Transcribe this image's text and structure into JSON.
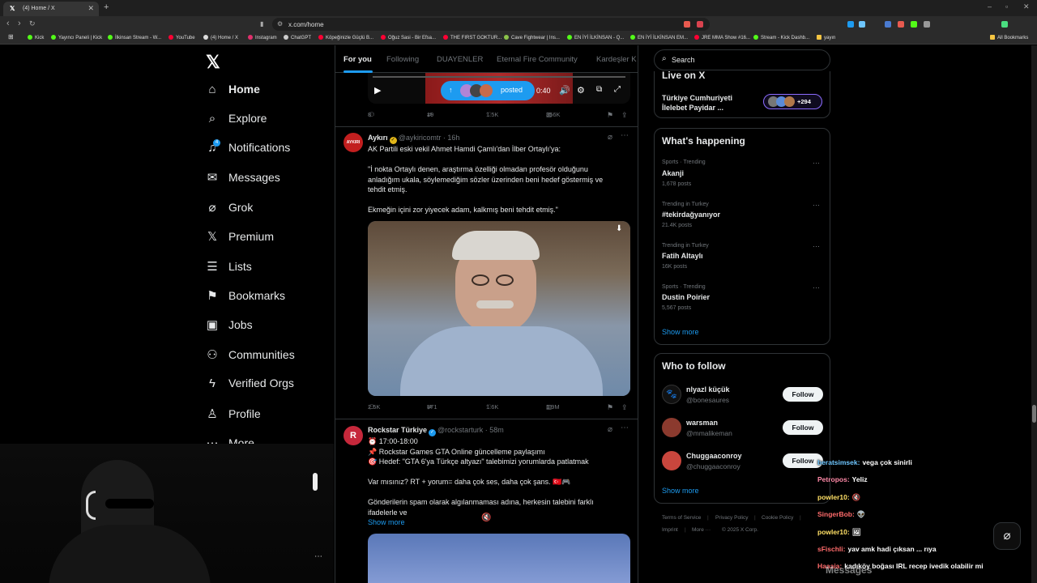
{
  "browser": {
    "tab_title": "(4) Home / X",
    "url": "x.com/home",
    "bookmarks": [
      "Kick",
      "Yayıncı Paneli | Kick",
      "İlkinsan Stream - W...",
      "YouTube",
      "(4) Home / X",
      "Instagram",
      "ChatGPT",
      "Köpeğinizle Güçlü B...",
      "Oğuz Sasi - Bir Efsa...",
      "THE FIRST GOKTUR...",
      "Cave Fightwear | Ins...",
      "EN İYİ İLKİNSAN - Q...",
      "EN İYİ İLKİNSAN EM...",
      "JRE MMA Show #16...",
      "Stream - Kick Dashb...",
      "yayın"
    ],
    "all_bookmarks": "All Bookmarks"
  },
  "nav": {
    "notif_badge": "4",
    "items": [
      {
        "label": "Home",
        "icon": "home-icon"
      },
      {
        "label": "Explore",
        "icon": "search-icon"
      },
      {
        "label": "Notifications",
        "icon": "bell-icon"
      },
      {
        "label": "Messages",
        "icon": "envelope-icon"
      },
      {
        "label": "Grok",
        "icon": "grok-icon"
      },
      {
        "label": "Premium",
        "icon": "x-icon"
      },
      {
        "label": "Lists",
        "icon": "list-icon"
      },
      {
        "label": "Bookmarks",
        "icon": "bookmark-icon"
      },
      {
        "label": "Jobs",
        "icon": "briefcase-icon"
      },
      {
        "label": "Communities",
        "icon": "people-icon"
      },
      {
        "label": "Verified Orgs",
        "icon": "bolt-icon"
      },
      {
        "label": "Profile",
        "icon": "person-icon"
      },
      {
        "label": "More",
        "icon": "more-icon"
      }
    ]
  },
  "feed": {
    "tabs": [
      "For you",
      "Following",
      "DUAYENLER",
      "Eternal Fire Community",
      "Kardeşler K"
    ],
    "video": {
      "time": "0:40",
      "posted_label": "posted"
    },
    "tweet0_stats": {
      "replies": "8",
      "retweets": "19",
      "likes": "1.5K",
      "views": "356K"
    },
    "tweet1": {
      "name": "Aykırı",
      "handle": "@aykiricomtr",
      "time": "· 16h",
      "avatar_text": "AYKIRI",
      "lines": [
        "AK Partili eski vekil Ahmet Hamdi Çamlı'dan İlber Ortaylı'ya:",
        "",
        "\"İ nokta Ortaylı denen, araştırma özelliği olmadan profesör olduğunu",
        "anladığım ukala, söylemediğim sözler üzerinden beni hedef göstermiş ve",
        "tehdit etmiş.",
        "",
        "Ekmeğin içini zor yiyecek adam, kalkmış beni tehdit etmiş.\""
      ],
      "stats": {
        "replies": "2.5K",
        "retweets": "571",
        "likes": "1.6K",
        "views": "1.9M"
      }
    },
    "tweet2": {
      "name": "Rockstar Türkiye",
      "handle": "@rockstarturk",
      "time": "· 58m",
      "lines": [
        "⏰ 17:00-18:00",
        "📌 Rockstar Games GTA Online güncelleme paylaşımı",
        "🎯 Hedef: \"GTA 6'ya Türkçe altyazı\" talebimizi yorumlarda patlatmak",
        "",
        "Var mısınız? RT + yorum= daha çok ses, daha çok şans. 🇹🇷🎮",
        "",
        "Gönderilerin spam olarak algılanmaması adına, herkesin talebini farklı",
        "ifadelerle ve"
      ],
      "show_more": "Show more"
    }
  },
  "right": {
    "search_placeholder": "Search",
    "live": {
      "title": "Live on X",
      "item": "Türkiye Cumhuriyeti İlelebet Payidar ...",
      "count": "+294"
    },
    "happening": {
      "title": "What's happening",
      "trends": [
        {
          "cat": "Sports · Trending",
          "name": "Akanji",
          "posts": "1,678 posts"
        },
        {
          "cat": "Trending in Turkey",
          "name": "#tekirdağyanıyor",
          "posts": "21.4K posts"
        },
        {
          "cat": "Trending in Turkey",
          "name": "Fatih Altaylı",
          "posts": "16K posts"
        },
        {
          "cat": "Sports · Trending",
          "name": "Dustin Poirier",
          "posts": "5,567 posts"
        }
      ],
      "show_more": "Show more"
    },
    "wtf": {
      "title": "Who to follow",
      "users": [
        {
          "name": "nlyazl küçük",
          "handle": "@bonesaures"
        },
        {
          "name": "warsman",
          "handle": "@mmalikeman"
        },
        {
          "name": "Chuggaaconroy",
          "handle": "@chuggaaconroy"
        }
      ],
      "follow_label": "Follow",
      "show_more": "Show more"
    },
    "footer": {
      "links": [
        "Terms of Service",
        "Privacy Policy",
        "Cookie Policy",
        "Imprint",
        "More ···"
      ],
      "copyright": "© 2025 X Corp."
    }
  },
  "chat": [
    {
      "user": "beratsimsek:",
      "msg": "vega çok sinirli",
      "color": "#6ec6ff"
    },
    {
      "user": "Petropos:",
      "msg": "Yeliz",
      "color": "#ff8aa8"
    },
    {
      "user": "powler10:",
      "msg": "🔇",
      "color": "#ffe066"
    },
    {
      "user": "SingerBob:",
      "msg": "👽",
      "color": "#ff6b6b"
    },
    {
      "user": "powler10:",
      "msg": "🖼",
      "color": "#ffe066"
    },
    {
      "user": "sFischli:",
      "msg": "yav amk hadi çıksan ... rıya",
      "color": "#ff6b6b"
    },
    {
      "user": "Haaaia:",
      "msg": "kadıköy boğası IRL recep ivedik olabilir mi",
      "color": "#ff6b6b"
    }
  ],
  "messages_label": "Messages",
  "colors": {
    "accent": "#1d9bf0",
    "bg": "#000000",
    "border": "#2f3336"
  }
}
